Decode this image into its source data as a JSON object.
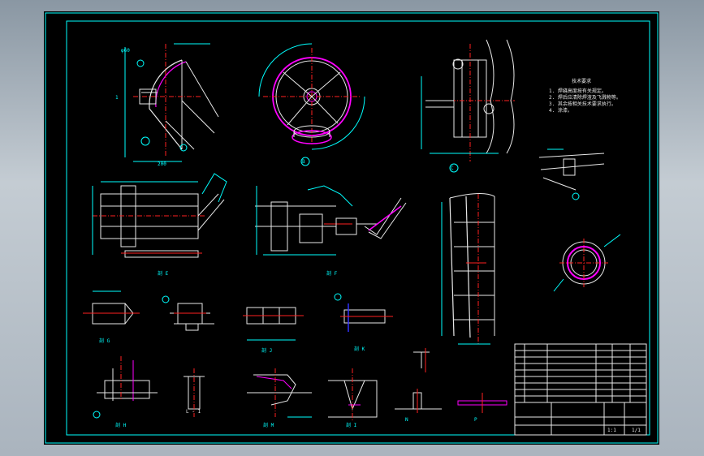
{
  "drawing": {
    "views": [
      {
        "id": "top-left",
        "label": "A"
      },
      {
        "id": "top-mid",
        "label": "B"
      },
      {
        "id": "top-right",
        "label": "C"
      },
      {
        "id": "detail-right",
        "label": "L"
      }
    ],
    "section_labels": [
      "剖 E",
      "剖 F",
      "剖 G",
      "剖 H",
      "L - 1",
      "剖 I"
    ],
    "scale_text": "1:1",
    "tech_title": "技术要求",
    "tech_lines": [
      "1. 焊缝高度按有关规定。",
      "2. 焊后应清除焊渣及飞溅物等。",
      "3. 其余按相关技术要求执行。",
      "4. 涂漆。"
    ],
    "title_block": {
      "rows": [
        "",
        "",
        "",
        "",
        "",
        "",
        "",
        "",
        ""
      ],
      "drawing_name": "",
      "sheet": "1/1"
    }
  },
  "colors": {
    "frame": "#00ffff",
    "geometry": "#e8e8e8",
    "highlight": "#ff00ff",
    "centerline": "#ff2020",
    "hidden": "#3030ff"
  }
}
